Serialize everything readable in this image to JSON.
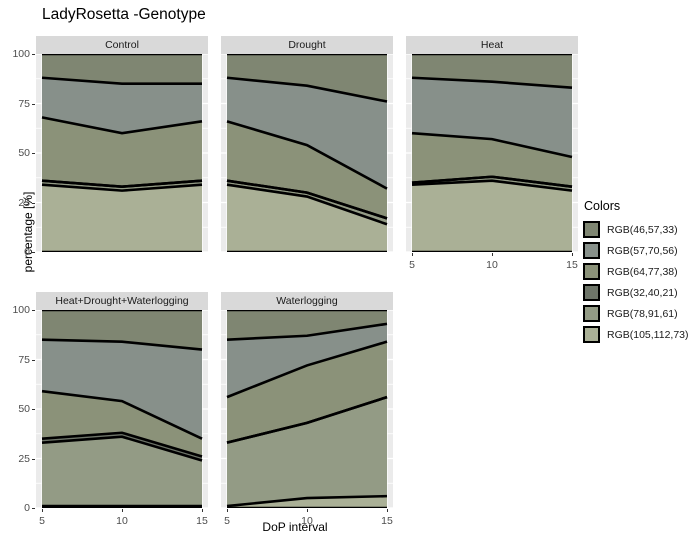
{
  "title": "LadyRosetta -Genotype",
  "axes": {
    "y_title": "percentage [%]",
    "x_title": "DoP interval",
    "y_ticks": [
      "0",
      "25",
      "50",
      "75",
      "100"
    ],
    "x_ticks": [
      "5",
      "10",
      "15"
    ]
  },
  "legend": {
    "title": "Colors",
    "items": [
      {
        "label": "RGB(46,57,33)",
        "color": "#7f8672"
      },
      {
        "label": "RGB(57,70,56)",
        "color": "#87908a"
      },
      {
        "label": "RGB(64,77,38)",
        "color": "#8b9279"
      },
      {
        "label": "RGB(32,40,21)",
        "color": "#6e7569"
      },
      {
        "label": "RGB(78,91,61)",
        "color": "#939b85"
      },
      {
        "label": "RGB(105,112,73)",
        "color": "#aab096"
      }
    ]
  },
  "panels": [
    {
      "label": "Control"
    },
    {
      "label": "Drought"
    },
    {
      "label": "Heat"
    },
    {
      "label": "Heat+Drought+Waterlogging"
    },
    {
      "label": "Waterlogging"
    }
  ],
  "chart_data": {
    "type": "area",
    "title": "LadyRosetta -Genotype",
    "xlabel": "DoP interval",
    "ylabel": "percentage [%]",
    "xlim": [
      5,
      15
    ],
    "ylim": [
      0,
      100
    ],
    "x": [
      5,
      10,
      15
    ],
    "grid": true,
    "legend_position": "right",
    "legend_title": "Colors",
    "stacked": true,
    "series_order": [
      "RGB(105,112,73)",
      "RGB(78,91,61)",
      "RGB(32,40,21)",
      "RGB(64,77,38)",
      "RGB(57,70,56)",
      "RGB(46,57,33)"
    ],
    "facets": [
      {
        "name": "Control",
        "cumulative_boundaries": [
          {
            "name": "RGB(105,112,73)",
            "values": [
              34,
              31,
              34
            ]
          },
          {
            "name": "RGB(78,91,61)",
            "values": [
              36,
              33,
              36
            ]
          },
          {
            "name": "RGB(32,40,21)",
            "values": [
              36,
              33,
              36
            ]
          },
          {
            "name": "RGB(64,77,38)",
            "values": [
              68,
              60,
              66
            ]
          },
          {
            "name": "RGB(57,70,56)",
            "values": [
              88,
              85,
              85
            ]
          },
          {
            "name": "RGB(46,57,33)",
            "values": [
              100,
              100,
              100
            ]
          }
        ],
        "band_values": [
          {
            "name": "RGB(105,112,73)",
            "values": [
              34,
              31,
              34
            ]
          },
          {
            "name": "RGB(78,91,61)",
            "values": [
              2,
              2,
              2
            ]
          },
          {
            "name": "RGB(32,40,21)",
            "values": [
              0,
              0,
              0
            ]
          },
          {
            "name": "RGB(64,77,38)",
            "values": [
              32,
              27,
              30
            ]
          },
          {
            "name": "RGB(57,70,56)",
            "values": [
              20,
              25,
              19
            ]
          },
          {
            "name": "RGB(46,57,33)",
            "values": [
              12,
              15,
              15
            ]
          }
        ]
      },
      {
        "name": "Drought",
        "cumulative_boundaries": [
          {
            "name": "RGB(105,112,73)",
            "values": [
              34,
              28,
              14
            ]
          },
          {
            "name": "RGB(78,91,61)",
            "values": [
              36,
              30,
              17
            ]
          },
          {
            "name": "RGB(32,40,21)",
            "values": [
              36,
              30,
              17
            ]
          },
          {
            "name": "RGB(64,77,38)",
            "values": [
              66,
              54,
              32
            ]
          },
          {
            "name": "RGB(57,70,56)",
            "values": [
              88,
              84,
              76
            ]
          },
          {
            "name": "RGB(46,57,33)",
            "values": [
              100,
              100,
              100
            ]
          }
        ],
        "band_values": [
          {
            "name": "RGB(105,112,73)",
            "values": [
              34,
              28,
              14
            ]
          },
          {
            "name": "RGB(78,91,61)",
            "values": [
              2,
              2,
              3
            ]
          },
          {
            "name": "RGB(32,40,21)",
            "values": [
              0,
              0,
              0
            ]
          },
          {
            "name": "RGB(64,77,38)",
            "values": [
              30,
              24,
              15
            ]
          },
          {
            "name": "RGB(57,70,56)",
            "values": [
              22,
              30,
              44
            ]
          },
          {
            "name": "RGB(46,57,33)",
            "values": [
              12,
              16,
              24
            ]
          }
        ]
      },
      {
        "name": "Heat",
        "cumulative_boundaries": [
          {
            "name": "RGB(105,112,73)",
            "values": [
              34,
              36,
              31
            ]
          },
          {
            "name": "RGB(78,91,61)",
            "values": [
              35,
              38,
              33
            ]
          },
          {
            "name": "RGB(32,40,21)",
            "values": [
              35,
              38,
              33
            ]
          },
          {
            "name": "RGB(64,77,38)",
            "values": [
              60,
              57,
              48
            ]
          },
          {
            "name": "RGB(57,70,56)",
            "values": [
              88,
              86,
              83
            ]
          },
          {
            "name": "RGB(46,57,33)",
            "values": [
              100,
              100,
              100
            ]
          }
        ],
        "band_values": [
          {
            "name": "RGB(105,112,73)",
            "values": [
              34,
              36,
              31
            ]
          },
          {
            "name": "RGB(78,91,61)",
            "values": [
              1,
              2,
              2
            ]
          },
          {
            "name": "RGB(32,40,21)",
            "values": [
              0,
              0,
              0
            ]
          },
          {
            "name": "RGB(64,77,38)",
            "values": [
              25,
              19,
              15
            ]
          },
          {
            "name": "RGB(57,70,56)",
            "values": [
              28,
              29,
              35
            ]
          },
          {
            "name": "RGB(46,57,33)",
            "values": [
              12,
              14,
              17
            ]
          }
        ]
      },
      {
        "name": "Heat+Drought+Waterlogging",
        "cumulative_boundaries": [
          {
            "name": "RGB(105,112,73)",
            "values": [
              1,
              1,
              1
            ]
          },
          {
            "name": "RGB(78,91,61)",
            "values": [
              33,
              36,
              24
            ]
          },
          {
            "name": "RGB(32,40,21)",
            "values": [
              35,
              38,
              26
            ]
          },
          {
            "name": "RGB(64,77,38)",
            "values": [
              59,
              54,
              35
            ]
          },
          {
            "name": "RGB(57,70,56)",
            "values": [
              85,
              84,
              80
            ]
          },
          {
            "name": "RGB(46,57,33)",
            "values": [
              100,
              100,
              100
            ]
          }
        ],
        "band_values": [
          {
            "name": "RGB(105,112,73)",
            "values": [
              1,
              1,
              1
            ]
          },
          {
            "name": "RGB(78,91,61)",
            "values": [
              32,
              35,
              23
            ]
          },
          {
            "name": "RGB(32,40,21)",
            "values": [
              2,
              2,
              2
            ]
          },
          {
            "name": "RGB(64,77,38)",
            "values": [
              24,
              16,
              9
            ]
          },
          {
            "name": "RGB(57,70,56)",
            "values": [
              26,
              30,
              45
            ]
          },
          {
            "name": "RGB(46,57,33)",
            "values": [
              15,
              16,
              20
            ]
          }
        ]
      },
      {
        "name": "Waterlogging",
        "cumulative_boundaries": [
          {
            "name": "RGB(105,112,73)",
            "values": [
              1,
              5,
              6
            ]
          },
          {
            "name": "RGB(78,91,61)",
            "values": [
              33,
              43,
              56
            ]
          },
          {
            "name": "RGB(32,40,21)",
            "values": [
              33,
              43,
              56
            ]
          },
          {
            "name": "RGB(64,77,38)",
            "values": [
              56,
              72,
              84
            ]
          },
          {
            "name": "RGB(57,70,56)",
            "values": [
              85,
              87,
              93
            ]
          },
          {
            "name": "RGB(46,57,33)",
            "values": [
              100,
              100,
              100
            ]
          }
        ],
        "band_values": [
          {
            "name": "RGB(105,112,73)",
            "values": [
              1,
              5,
              6
            ]
          },
          {
            "name": "RGB(78,91,61)",
            "values": [
              32,
              38,
              50
            ]
          },
          {
            "name": "RGB(32,40,21)",
            "values": [
              0,
              0,
              0
            ]
          },
          {
            "name": "RGB(64,77,38)",
            "values": [
              23,
              29,
              28
            ]
          },
          {
            "name": "RGB(57,70,56)",
            "values": [
              29,
              15,
              9
            ]
          },
          {
            "name": "RGB(46,57,33)",
            "values": [
              15,
              13,
              7
            ]
          }
        ]
      }
    ]
  }
}
